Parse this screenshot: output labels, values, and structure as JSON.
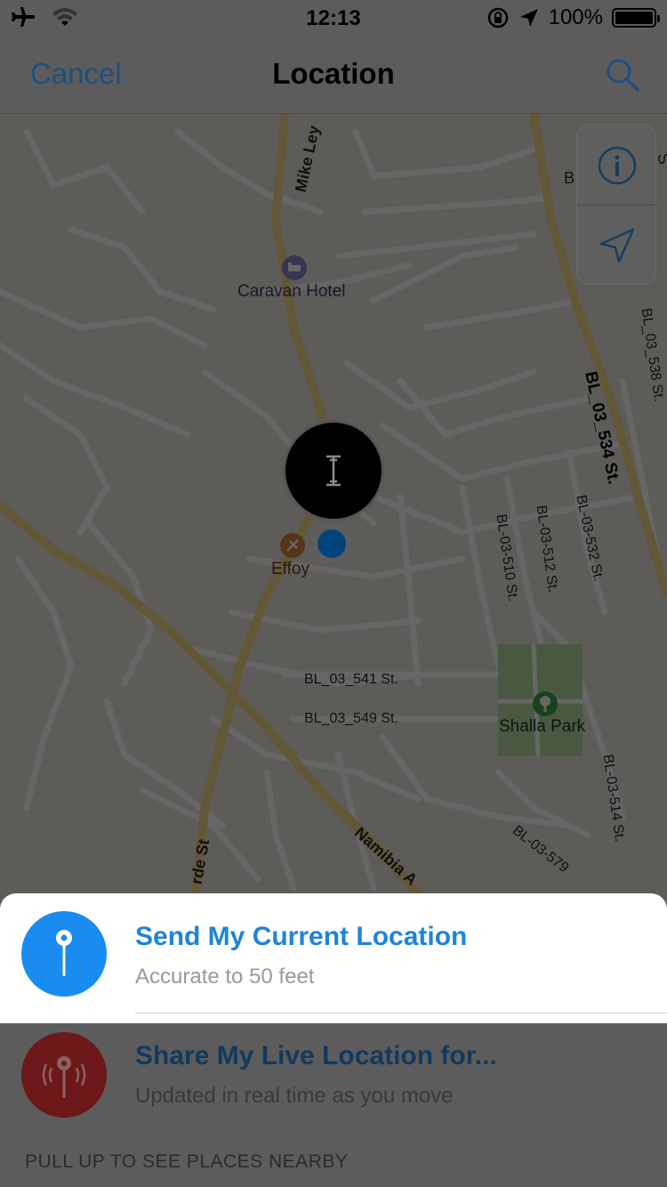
{
  "status_bar": {
    "time": "12:13",
    "battery_text": "100%",
    "icons": [
      "airplane-icon",
      "wifi-icon",
      "orientation-lock-icon",
      "location-arrow-icon",
      "battery-icon"
    ]
  },
  "nav": {
    "cancel_label": "Cancel",
    "title": "Location",
    "search_icon": "search-icon"
  },
  "map": {
    "controls": [
      "info-icon",
      "locate-arrow-icon"
    ],
    "pois": {
      "hotel": "Caravan Hotel",
      "restaurant": "Effoy",
      "park": "Shalla Park"
    },
    "streets": {
      "mike_ley": "Mike Ley",
      "bl_534": "BL_03_534 St.",
      "bl_538": "BL_03_538 St.",
      "bl_510": "BL-03-510 St.",
      "bl_512": "BL-03-512 St.",
      "bl_532": "BL-03-532 St.",
      "bl_541": "BL_03_541 St.",
      "bl_549": "BL_03_549 St.",
      "bl_514": "BL-03-514 St.",
      "bl_579": "BL-03-579",
      "namibia": "Namibia A",
      "rde_st": "rde St",
      "b_edge": "B",
      "s_edge": "S"
    },
    "accent_color": "#1a8cf0"
  },
  "options": {
    "current": {
      "title": "Send My Current Location",
      "subtitle": "Accurate to 50 feet"
    },
    "live": {
      "title": "Share My Live Location for...",
      "subtitle": "Updated in real time as you move"
    }
  },
  "pull_hint": "PULL UP TO SEE PLACES NEARBY"
}
